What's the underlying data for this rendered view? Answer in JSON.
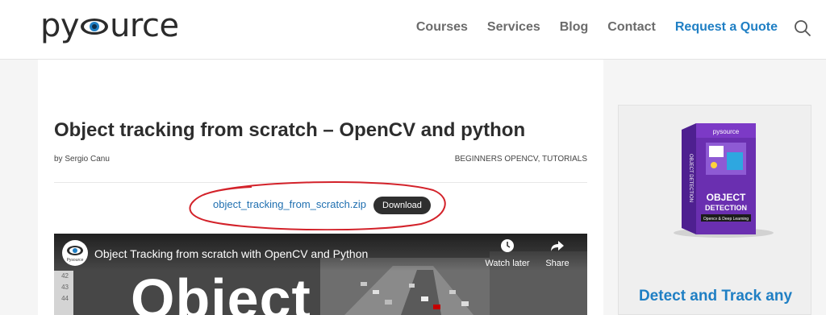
{
  "header": {
    "logo_text_before": "py",
    "logo_text_after": "urce",
    "nav": [
      {
        "label": "Courses"
      },
      {
        "label": "Services"
      },
      {
        "label": "Blog"
      },
      {
        "label": "Contact"
      },
      {
        "label": "Request a Quote"
      }
    ]
  },
  "post": {
    "title": "Object tracking from scratch – OpenCV and python",
    "byline": "by Sergio Canu",
    "categories": "BEGINNERS OPENCV, TUTORIALS",
    "download_file": "object_tracking_from_scratch.zip",
    "download_label": "Download"
  },
  "video": {
    "channel_name": "Pysource",
    "title": "Object Tracking from scratch with OpenCV and Python",
    "watch_later_label": "Watch later",
    "share_label": "Share",
    "overlay_word": "Object",
    "ruler": [
      "42",
      "43",
      "44"
    ]
  },
  "sidebar": {
    "book_brand": "pysource",
    "book_title_1": "OBJECT",
    "book_title_2": "DETECTION",
    "book_subtitle": "Opencv & Deep Learning",
    "book_spine": "OBJECT DETECTION",
    "promo_text": "Detect and Track any"
  },
  "colors": {
    "accent": "#1f7fc4",
    "highlight_ring": "#d3222a",
    "book_purple": "#6a2fb0"
  }
}
